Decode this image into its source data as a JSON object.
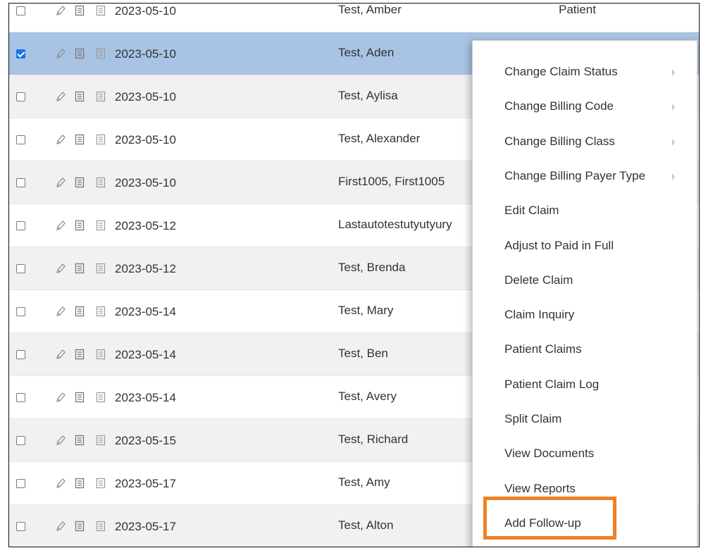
{
  "grid": {
    "rows": [
      {
        "checked": false,
        "date": "2023-05-10",
        "name": "Test, Amber",
        "type": "Patient",
        "style": "partial"
      },
      {
        "checked": true,
        "date": "2023-05-10",
        "name": "Test, Aden",
        "type": "",
        "style": "selected"
      },
      {
        "checked": false,
        "date": "2023-05-10",
        "name": "Test, Aylisa",
        "type": "",
        "style": "alt"
      },
      {
        "checked": false,
        "date": "2023-05-10",
        "name": "Test, Alexander",
        "type": "",
        "style": "plain"
      },
      {
        "checked": false,
        "date": "2023-05-10",
        "name": "First1005, First1005",
        "type": "",
        "style": "alt"
      },
      {
        "checked": false,
        "date": "2023-05-12",
        "name": "Lastautotestutyutyury",
        "type": "",
        "style": "plain"
      },
      {
        "checked": false,
        "date": "2023-05-12",
        "name": "Test, Brenda",
        "type": "",
        "style": "alt"
      },
      {
        "checked": false,
        "date": "2023-05-14",
        "name": "Test, Mary",
        "type": "",
        "style": "plain"
      },
      {
        "checked": false,
        "date": "2023-05-14",
        "name": "Test, Ben",
        "type": "",
        "style": "alt"
      },
      {
        "checked": false,
        "date": "2023-05-14",
        "name": "Test, Avery",
        "type": "",
        "style": "plain"
      },
      {
        "checked": false,
        "date": "2023-05-15",
        "name": "Test, Richard",
        "type": "",
        "style": "alt"
      },
      {
        "checked": false,
        "date": "2023-05-17",
        "name": "Test, Amy",
        "type": "",
        "style": "plain"
      },
      {
        "checked": false,
        "date": "2023-05-17",
        "name": "Test, Alton",
        "type": "",
        "style": "alt"
      }
    ]
  },
  "context_menu": {
    "items": [
      {
        "label": "Change Claim Status",
        "submenu": true
      },
      {
        "label": "Change Billing Code",
        "submenu": true
      },
      {
        "label": "Change Billing Class",
        "submenu": true
      },
      {
        "label": "Change Billing Payer Type",
        "submenu": true
      },
      {
        "label": "Edit Claim",
        "submenu": false
      },
      {
        "label": "Adjust to Paid in Full",
        "submenu": false
      },
      {
        "label": "Delete Claim",
        "submenu": false
      },
      {
        "label": "Claim Inquiry",
        "submenu": false
      },
      {
        "label": "Patient Claims",
        "submenu": false
      },
      {
        "label": "Patient Claim Log",
        "submenu": false
      },
      {
        "label": "Split Claim",
        "submenu": false
      },
      {
        "label": "View Documents",
        "submenu": false
      },
      {
        "label": "View Reports",
        "submenu": false
      },
      {
        "label": "Add Follow-up",
        "submenu": false,
        "highlighted": true
      }
    ]
  },
  "icons": {
    "row_actions": [
      "pencil-icon",
      "document-icon",
      "notes-icon"
    ],
    "submenu": "chevron-right-icon"
  },
  "colors": {
    "selected_row": "#a9c3e4",
    "checkbox_on": "#1a73e8",
    "highlight_box": "#f07f23"
  }
}
